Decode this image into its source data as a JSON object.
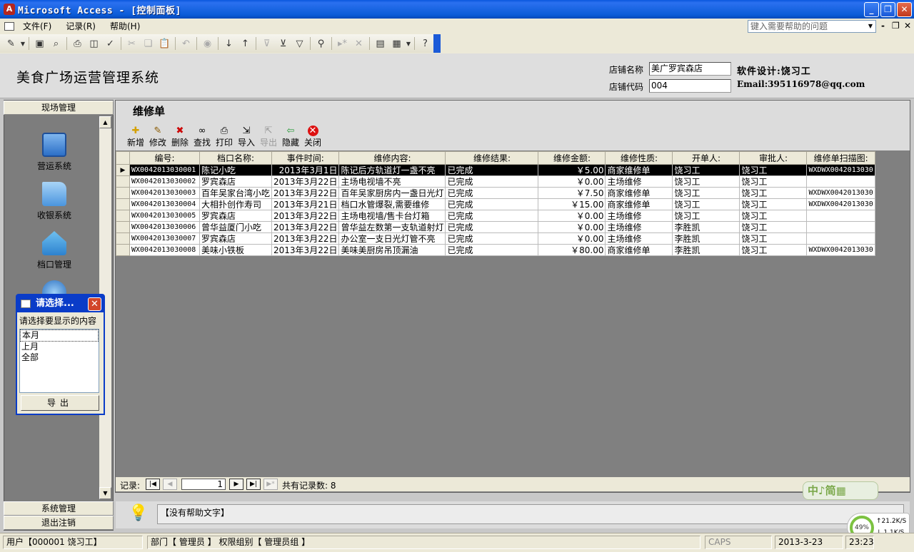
{
  "window": {
    "title": "Microsoft Access - [控制面板]",
    "help_placeholder": "键入需要帮助的问题"
  },
  "menu": [
    "文件(F)",
    "记录(R)",
    "帮助(H)"
  ],
  "header": {
    "app_title": "美食广场运营管理系统",
    "shop_name_label": "店铺名称",
    "shop_name": "美广罗宾森店",
    "shop_code_label": "店铺代码",
    "shop_code": "004",
    "design": "软件设计:饶习工",
    "email": "Email:395116978@qq.com"
  },
  "sidebar": {
    "top_button": "现场管理",
    "items": [
      {
        "label": "营运系统",
        "icon": "chart-window-icon"
      },
      {
        "label": "收银系统",
        "icon": "folder-icon"
      },
      {
        "label": "档口管理",
        "icon": "house-icon"
      },
      {
        "label": "",
        "icon": "globe-icon"
      }
    ],
    "bottom_buttons": [
      "系统管理",
      "退出注销"
    ]
  },
  "panel": {
    "title": "维修单",
    "actions": [
      {
        "label": "新增",
        "icon": "new-icon",
        "enabled": true
      },
      {
        "label": "修改",
        "icon": "edit-icon",
        "enabled": true
      },
      {
        "label": "删除",
        "icon": "delete-icon",
        "enabled": true
      },
      {
        "label": "查找",
        "icon": "binoculars-icon",
        "enabled": true
      },
      {
        "label": "打印",
        "icon": "printer-icon",
        "enabled": true
      },
      {
        "label": "导入",
        "icon": "import-icon",
        "enabled": true
      },
      {
        "label": "导出",
        "icon": "export-icon",
        "enabled": false
      },
      {
        "label": "隐藏",
        "icon": "back-arrow-icon",
        "enabled": true
      },
      {
        "label": "关闭",
        "icon": "close-red-icon",
        "enabled": true
      }
    ]
  },
  "table": {
    "columns": [
      "编号:",
      "档口名称:",
      "事件时间:",
      "维修内容:",
      "维修结果:",
      "维修金额:",
      "维修性质:",
      "开单人:",
      "审批人:",
      "维修单扫描图:"
    ],
    "rows": [
      [
        "WX0042013030001",
        "陈记小吃",
        "2013年3月1日",
        "陈记后方轨道灯一盏不亮",
        "已完成",
        "￥5.00",
        "商家维修单",
        "饶习工",
        "饶习工",
        "WXDWX0042013030"
      ],
      [
        "WX0042013030002",
        "罗宾森店",
        "2013年3月22日",
        "主场电视墙不亮",
        "已完成",
        "￥0.00",
        "主场维修",
        "饶习工",
        "饶习工",
        ""
      ],
      [
        "WX0042013030003",
        "百年吴家台湾小吃",
        "2013年3月22日",
        "百年吴家厨房内一盏日光灯",
        "已完成",
        "￥7.50",
        "商家维修单",
        "饶习工",
        "饶习工",
        "WXDWX0042013030"
      ],
      [
        "WX0042013030004",
        "大相扑创作寿司",
        "2013年3月21日",
        "档口水管爆裂,需要维修",
        "已完成",
        "￥15.00",
        "商家维修单",
        "饶习工",
        "饶习工",
        "WXDWX0042013030"
      ],
      [
        "WX0042013030005",
        "罗宾森店",
        "2013年3月22日",
        "主场电视墙/售卡台灯箱",
        "已完成",
        "￥0.00",
        "主场维修",
        "饶习工",
        "饶习工",
        ""
      ],
      [
        "WX0042013030006",
        "曾华益厦门小吃",
        "2013年3月22日",
        "曾华益左数第一支轨道射灯",
        "已完成",
        "￥0.00",
        "主场维修",
        "李胜凯",
        "饶习工",
        ""
      ],
      [
        "WX0042013030007",
        "罗宾森店",
        "2013年3月22日",
        "办公室一支日光灯管不亮",
        "已完成",
        "￥0.00",
        "主场维修",
        "李胜凯",
        "饶习工",
        ""
      ],
      [
        "WX0042013030008",
        "美味小铁板",
        "2013年3月22日",
        "美味美厨房吊顶漏油",
        "已完成",
        "￥80.00",
        "商家维修单",
        "李胜凯",
        "饶习工",
        "WXDWX0042013030"
      ]
    ]
  },
  "record_nav": {
    "label": "记录:",
    "current": "1",
    "total_text": "共有记录数: 8"
  },
  "help_text": "【没有帮助文字】",
  "dialog": {
    "title": "请选择...",
    "prompt": "请选择要显示的内容",
    "options": [
      "本月",
      "上月",
      "全部"
    ],
    "selected": "本月",
    "button": "导出"
  },
  "status": {
    "user": "用户【000001 饶习工】",
    "dept": "部门【 管理员 】 权限组别【 管理员组 】",
    "caps": "CAPS",
    "date": "2013-3-23",
    "time": "23:23"
  },
  "overlays": {
    "ime": "中♪简▦",
    "net_percent": "49%",
    "net_up": "↑21.2K/S",
    "net_down": "↓ 1.1K/S"
  }
}
